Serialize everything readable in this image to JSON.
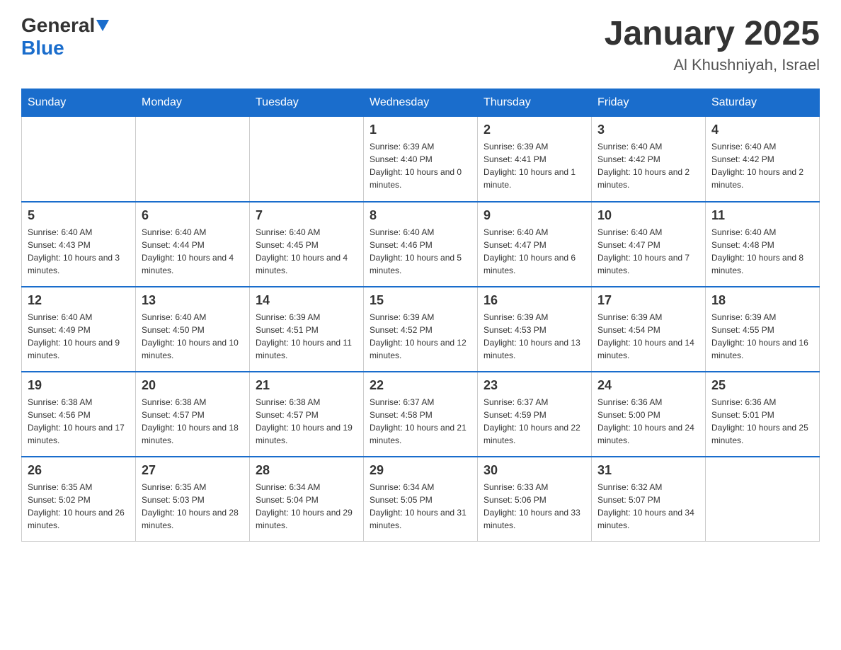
{
  "header": {
    "logo_general": "General",
    "logo_blue": "Blue",
    "month_title": "January 2025",
    "location": "Al Khushniyah, Israel"
  },
  "days_of_week": [
    "Sunday",
    "Monday",
    "Tuesday",
    "Wednesday",
    "Thursday",
    "Friday",
    "Saturday"
  ],
  "weeks": [
    [
      {
        "day": "",
        "info": ""
      },
      {
        "day": "",
        "info": ""
      },
      {
        "day": "",
        "info": ""
      },
      {
        "day": "1",
        "info": "Sunrise: 6:39 AM\nSunset: 4:40 PM\nDaylight: 10 hours and 0 minutes."
      },
      {
        "day": "2",
        "info": "Sunrise: 6:39 AM\nSunset: 4:41 PM\nDaylight: 10 hours and 1 minute."
      },
      {
        "day": "3",
        "info": "Sunrise: 6:40 AM\nSunset: 4:42 PM\nDaylight: 10 hours and 2 minutes."
      },
      {
        "day": "4",
        "info": "Sunrise: 6:40 AM\nSunset: 4:42 PM\nDaylight: 10 hours and 2 minutes."
      }
    ],
    [
      {
        "day": "5",
        "info": "Sunrise: 6:40 AM\nSunset: 4:43 PM\nDaylight: 10 hours and 3 minutes."
      },
      {
        "day": "6",
        "info": "Sunrise: 6:40 AM\nSunset: 4:44 PM\nDaylight: 10 hours and 4 minutes."
      },
      {
        "day": "7",
        "info": "Sunrise: 6:40 AM\nSunset: 4:45 PM\nDaylight: 10 hours and 4 minutes."
      },
      {
        "day": "8",
        "info": "Sunrise: 6:40 AM\nSunset: 4:46 PM\nDaylight: 10 hours and 5 minutes."
      },
      {
        "day": "9",
        "info": "Sunrise: 6:40 AM\nSunset: 4:47 PM\nDaylight: 10 hours and 6 minutes."
      },
      {
        "day": "10",
        "info": "Sunrise: 6:40 AM\nSunset: 4:47 PM\nDaylight: 10 hours and 7 minutes."
      },
      {
        "day": "11",
        "info": "Sunrise: 6:40 AM\nSunset: 4:48 PM\nDaylight: 10 hours and 8 minutes."
      }
    ],
    [
      {
        "day": "12",
        "info": "Sunrise: 6:40 AM\nSunset: 4:49 PM\nDaylight: 10 hours and 9 minutes."
      },
      {
        "day": "13",
        "info": "Sunrise: 6:40 AM\nSunset: 4:50 PM\nDaylight: 10 hours and 10 minutes."
      },
      {
        "day": "14",
        "info": "Sunrise: 6:39 AM\nSunset: 4:51 PM\nDaylight: 10 hours and 11 minutes."
      },
      {
        "day": "15",
        "info": "Sunrise: 6:39 AM\nSunset: 4:52 PM\nDaylight: 10 hours and 12 minutes."
      },
      {
        "day": "16",
        "info": "Sunrise: 6:39 AM\nSunset: 4:53 PM\nDaylight: 10 hours and 13 minutes."
      },
      {
        "day": "17",
        "info": "Sunrise: 6:39 AM\nSunset: 4:54 PM\nDaylight: 10 hours and 14 minutes."
      },
      {
        "day": "18",
        "info": "Sunrise: 6:39 AM\nSunset: 4:55 PM\nDaylight: 10 hours and 16 minutes."
      }
    ],
    [
      {
        "day": "19",
        "info": "Sunrise: 6:38 AM\nSunset: 4:56 PM\nDaylight: 10 hours and 17 minutes."
      },
      {
        "day": "20",
        "info": "Sunrise: 6:38 AM\nSunset: 4:57 PM\nDaylight: 10 hours and 18 minutes."
      },
      {
        "day": "21",
        "info": "Sunrise: 6:38 AM\nSunset: 4:57 PM\nDaylight: 10 hours and 19 minutes."
      },
      {
        "day": "22",
        "info": "Sunrise: 6:37 AM\nSunset: 4:58 PM\nDaylight: 10 hours and 21 minutes."
      },
      {
        "day": "23",
        "info": "Sunrise: 6:37 AM\nSunset: 4:59 PM\nDaylight: 10 hours and 22 minutes."
      },
      {
        "day": "24",
        "info": "Sunrise: 6:36 AM\nSunset: 5:00 PM\nDaylight: 10 hours and 24 minutes."
      },
      {
        "day": "25",
        "info": "Sunrise: 6:36 AM\nSunset: 5:01 PM\nDaylight: 10 hours and 25 minutes."
      }
    ],
    [
      {
        "day": "26",
        "info": "Sunrise: 6:35 AM\nSunset: 5:02 PM\nDaylight: 10 hours and 26 minutes."
      },
      {
        "day": "27",
        "info": "Sunrise: 6:35 AM\nSunset: 5:03 PM\nDaylight: 10 hours and 28 minutes."
      },
      {
        "day": "28",
        "info": "Sunrise: 6:34 AM\nSunset: 5:04 PM\nDaylight: 10 hours and 29 minutes."
      },
      {
        "day": "29",
        "info": "Sunrise: 6:34 AM\nSunset: 5:05 PM\nDaylight: 10 hours and 31 minutes."
      },
      {
        "day": "30",
        "info": "Sunrise: 6:33 AM\nSunset: 5:06 PM\nDaylight: 10 hours and 33 minutes."
      },
      {
        "day": "31",
        "info": "Sunrise: 6:32 AM\nSunset: 5:07 PM\nDaylight: 10 hours and 34 minutes."
      },
      {
        "day": "",
        "info": ""
      }
    ]
  ]
}
